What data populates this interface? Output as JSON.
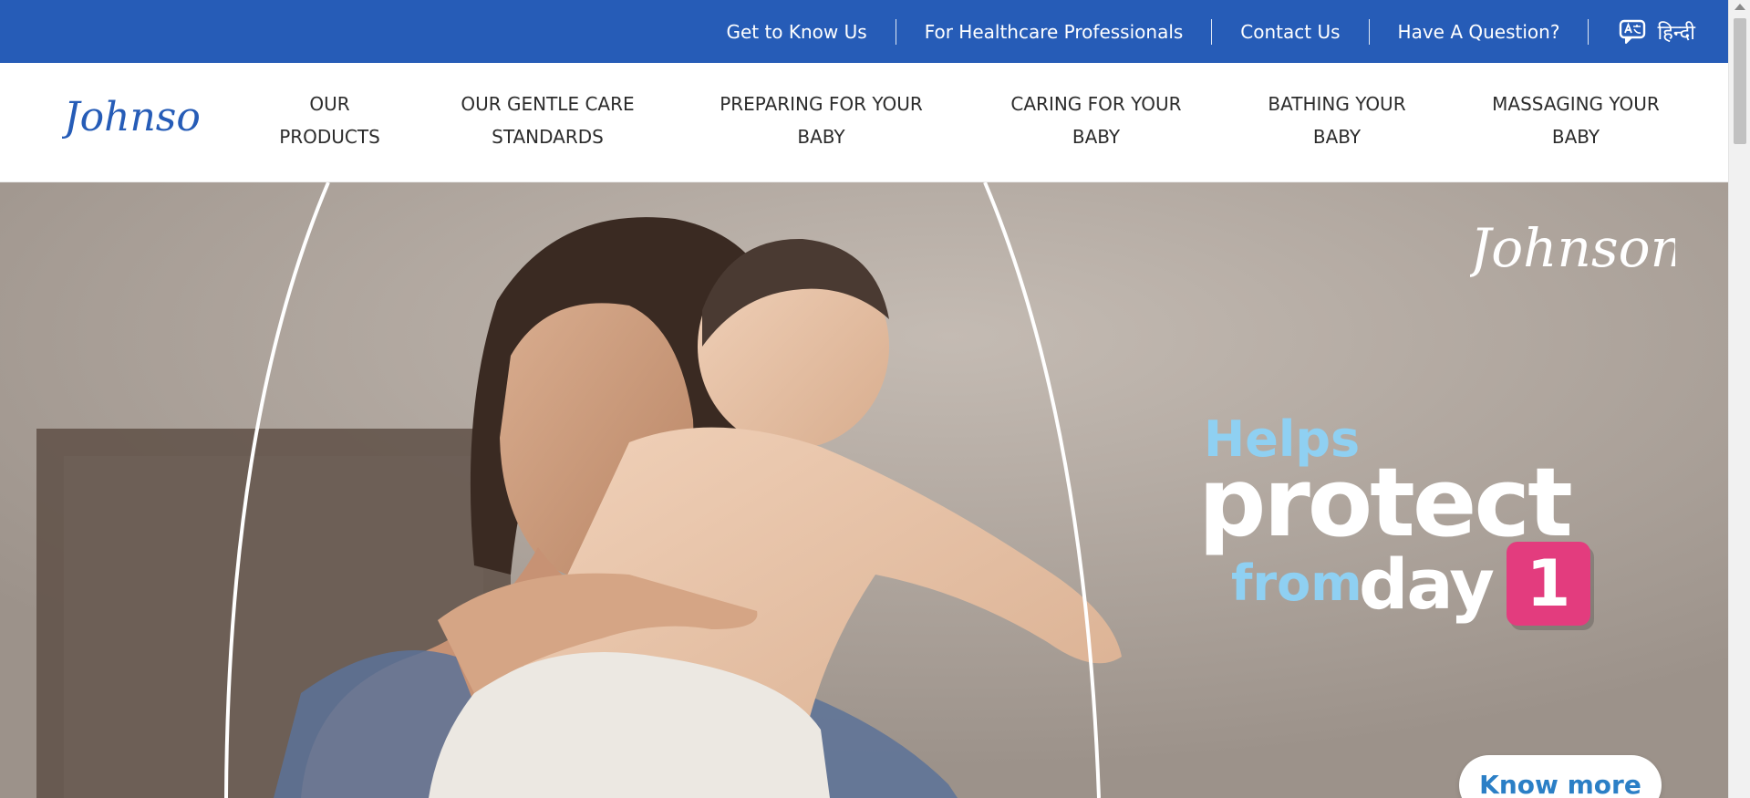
{
  "utility_bar": {
    "links": [
      "Get to Know Us",
      "For Healthcare Professionals",
      "Contact Us",
      "Have A Question?"
    ],
    "language_label": "हिन्दी",
    "language_icon": "language-translate-icon"
  },
  "brand": {
    "logo_text": "Johnson's"
  },
  "main_nav": {
    "items": [
      {
        "line1": "OUR",
        "line2": "PRODUCTS"
      },
      {
        "line1": "OUR GENTLE CARE",
        "line2": "STANDARDS"
      },
      {
        "line1": "PREPARING FOR YOUR",
        "line2": "BABY"
      },
      {
        "line1": "CARING FOR YOUR",
        "line2": "BABY"
      },
      {
        "line1": "BATHING YOUR",
        "line2": "BABY"
      },
      {
        "line1": "MASSAGING YOUR",
        "line2": "BABY"
      }
    ]
  },
  "hero": {
    "logo_text": "Johnson's",
    "headline": {
      "helps": "Helps",
      "protect": "protect",
      "from": "from",
      "day": "day",
      "number": "1"
    },
    "cta_label": "Know more"
  },
  "colors": {
    "utility_bar_bg": "#265cb7",
    "brand_blue": "#265cb7",
    "headline_light_blue": "#8fd0f2",
    "badge_pink": "#e33c7e",
    "cta_text_blue": "#2b7fc6"
  }
}
